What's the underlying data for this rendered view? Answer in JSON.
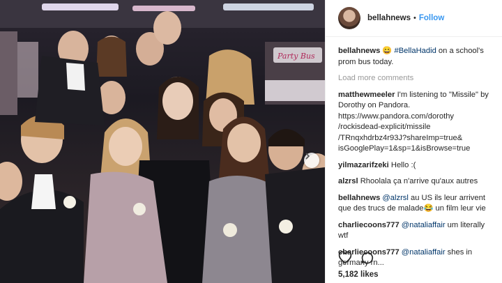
{
  "header": {
    "username": "bellahnews",
    "separator": "•",
    "follow_label": "Follow"
  },
  "caption": {
    "user": "bellahnews",
    "emoji": "😄",
    "hashtag": "#BellaHadid",
    "text": " on a school's prom bus today."
  },
  "load_more": "Load more comments",
  "comments": [
    {
      "user": "matthewmeeler",
      "mention": "",
      "text": "I'm listening to \"Missile\" by Dorothy on Pandora. https://www.pandora.com/dorothy /rockisdead-explicit/missile /TRnqxhdrbz4r93J?shareImp=true& isGooglePlay=1&sp=1&isBrowse=true"
    },
    {
      "user": "yilmazarifzeki",
      "mention": "",
      "text": "Hello :("
    },
    {
      "user": "alzrsl",
      "mention": "",
      "text": "Rhoolala ça n'arrive qu'aux autres"
    },
    {
      "user": "bellahnews",
      "mention": "@alzrsl",
      "text": " au US ils leur arrivent que des trucs de malade😂 un film leur vie"
    },
    {
      "user": "charliecoons777",
      "mention": "@nataliaffair",
      "text": " um literally wtf"
    },
    {
      "user": "charliecoons777",
      "mention": "@nataliaffair",
      "text": " shes in germany rn..."
    }
  ],
  "likes": "5,182 likes",
  "photo": {
    "sign_text": "Party Bus"
  },
  "colors": {
    "link": "#3897f0",
    "hashtag": "#003569",
    "muted": "#999999"
  }
}
